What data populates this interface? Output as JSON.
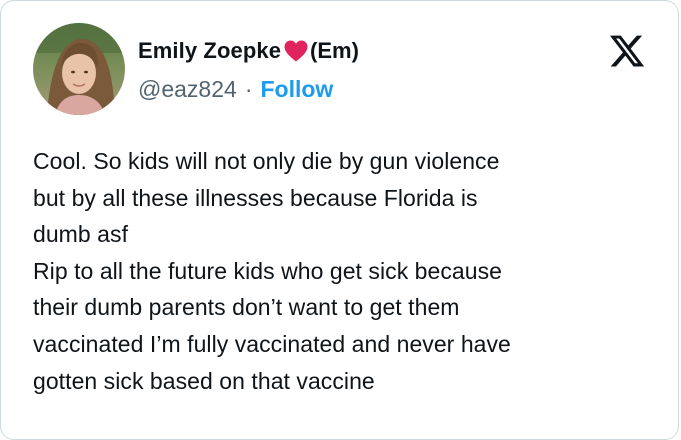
{
  "author": {
    "display_name": "Emily Zoepke",
    "nickname": "(Em)",
    "handle": "@eaz824",
    "separator": "·",
    "follow_label": "Follow"
  },
  "icons": {
    "avatar": "profile-photo",
    "name_emoji": "red-heart-icon",
    "platform_logo": "x-logo-icon"
  },
  "colors": {
    "follow": "#1d9bf0",
    "secondary_text": "#536471",
    "primary_text": "#0f1419",
    "heart": "#e0245e",
    "border": "#cfd9de"
  },
  "tweet": {
    "lines": [
      "Cool. So kids will not only die by gun violence",
      "but by all these illnesses because Florida is",
      "dumb asf",
      "Rip to all the future kids who get sick because",
      "their dumb parents don’t want to get them",
      "vaccinated I’m fully vaccinated and never have",
      "gotten sick based on that vaccine"
    ]
  }
}
